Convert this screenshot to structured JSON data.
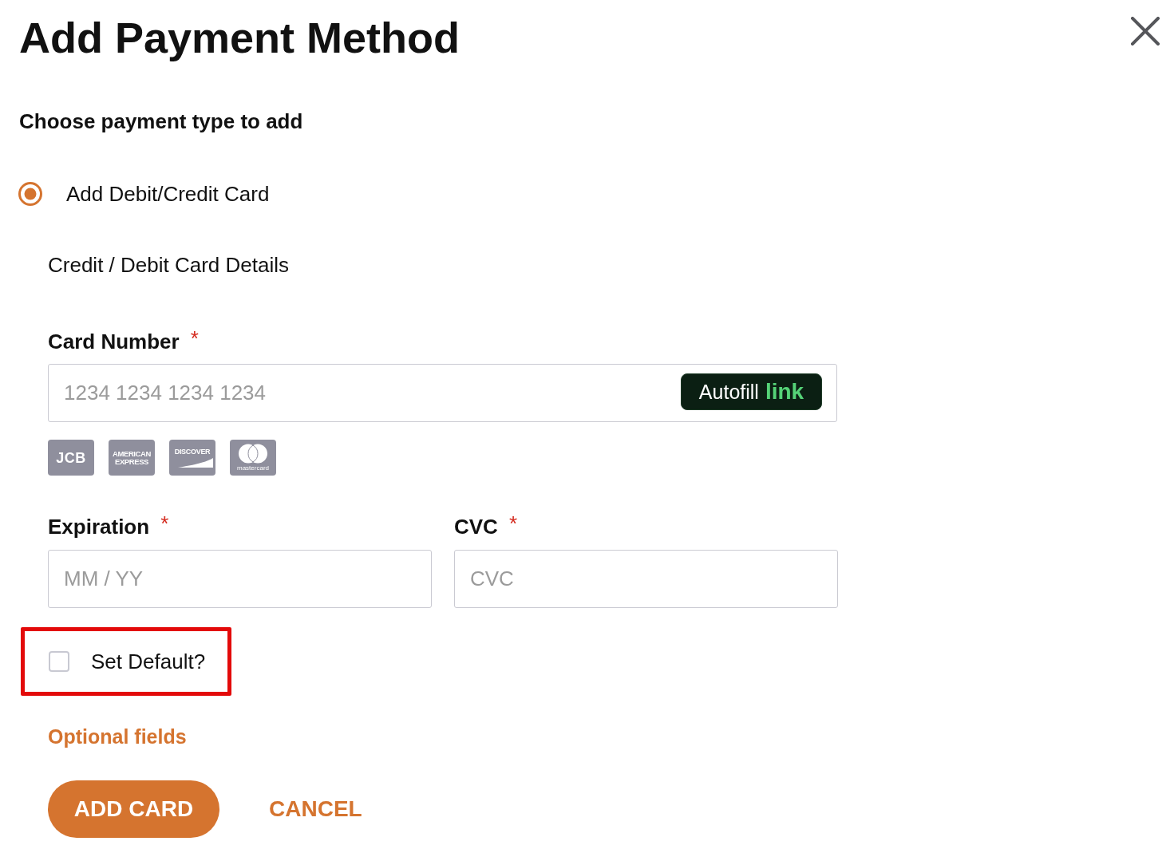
{
  "dialog": {
    "title": "Add Payment Method"
  },
  "payment_type": {
    "heading": "Choose payment type to add",
    "options": [
      {
        "label": "Add Debit/Credit Card",
        "selected": true
      }
    ]
  },
  "card_details": {
    "heading": "Credit / Debit Card Details",
    "card_number": {
      "label": "Card Number",
      "required_mark": "*",
      "placeholder": "1234 1234 1234 1234"
    },
    "autofill_button": {
      "label": "Autofill",
      "brand": "link"
    },
    "card_brands": [
      {
        "kind": "jcb",
        "name": "JCB"
      },
      {
        "kind": "amex",
        "name": "AMERICAN EXPRESS"
      },
      {
        "kind": "discover",
        "name": "DISCOVER"
      },
      {
        "kind": "mastercard",
        "name": "mastercard"
      }
    ],
    "row_fields": [
      {
        "label": "Expiration",
        "required_mark": "*",
        "placeholder": "MM / YY"
      },
      {
        "label": "CVC",
        "required_mark": "*",
        "placeholder": "CVC"
      }
    ]
  },
  "set_default": {
    "label": "Set Default?",
    "checked": false,
    "highlighted": true
  },
  "optional_fields_link": "Optional fields",
  "actions": [
    {
      "label": "ADD CARD",
      "kind": "primary"
    },
    {
      "label": "CANCEL",
      "kind": "text"
    }
  ]
}
